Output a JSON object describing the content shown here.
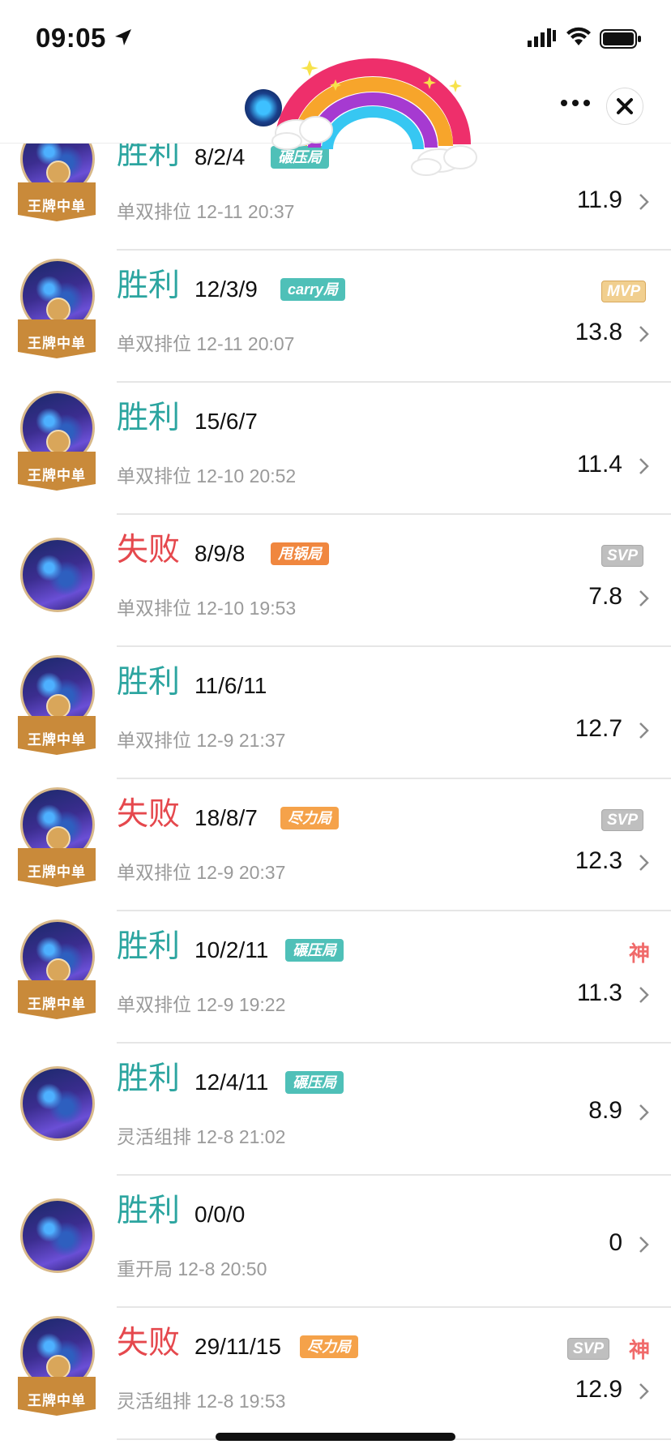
{
  "status_bar": {
    "time": "09:05"
  },
  "nav": {
    "title": ""
  },
  "colors": {
    "win": "#2ca5a0",
    "lose": "#e5484d",
    "teal_tag": "#4fc0b8",
    "orange_tag": "#f0873f",
    "amber_tag": "#f5a24a"
  },
  "matches": [
    {
      "result": "胜利",
      "kda": "8/2/4",
      "tag": "碾压局",
      "mode": "单双排位",
      "time": "12-11 20:37",
      "score": "11.9",
      "badge": "",
      "shen": "",
      "medal": "王牌中单"
    },
    {
      "result": "胜利",
      "kda": "12/3/9",
      "tag": "carry局",
      "mode": "单双排位",
      "time": "12-11 20:07",
      "score": "13.8",
      "badge": "MVP",
      "shen": "",
      "medal": "王牌中单"
    },
    {
      "result": "胜利",
      "kda": "15/6/7",
      "tag": "",
      "mode": "单双排位",
      "time": "12-10 20:52",
      "score": "11.4",
      "badge": "",
      "shen": "",
      "medal": "王牌中单"
    },
    {
      "result": "失败",
      "kda": "8/9/8",
      "tag": "甩锅局",
      "mode": "单双排位",
      "time": "12-10 19:53",
      "score": "7.8",
      "badge": "SVP",
      "shen": "",
      "medal": ""
    },
    {
      "result": "胜利",
      "kda": "11/6/11",
      "tag": "",
      "mode": "单双排位",
      "time": "12-9 21:37",
      "score": "12.7",
      "badge": "",
      "shen": "",
      "medal": "王牌中单"
    },
    {
      "result": "失败",
      "kda": "18/8/7",
      "tag": "尽力局",
      "mode": "单双排位",
      "time": "12-9 20:37",
      "score": "12.3",
      "badge": "SVP",
      "shen": "",
      "medal": "王牌中单"
    },
    {
      "result": "胜利",
      "kda": "10/2/11",
      "tag": "碾压局",
      "mode": "单双排位",
      "time": "12-9 19:22",
      "score": "11.3",
      "badge": "",
      "shen": "神",
      "medal": "王牌中单"
    },
    {
      "result": "胜利",
      "kda": "12/4/11",
      "tag": "碾压局",
      "mode": "灵活组排",
      "time": "12-8 21:02",
      "score": "8.9",
      "badge": "",
      "shen": "",
      "medal": ""
    },
    {
      "result": "胜利",
      "kda": "0/0/0",
      "tag": "",
      "mode": "重开局",
      "time": "12-8 20:50",
      "score": "0",
      "badge": "",
      "shen": "",
      "medal": ""
    },
    {
      "result": "失败",
      "kda": "29/11/15",
      "tag": "尽力局",
      "mode": "灵活组排",
      "time": "12-8 19:53",
      "score": "12.9",
      "badge": "SVP",
      "shen": "神",
      "medal": "王牌中单"
    }
  ]
}
